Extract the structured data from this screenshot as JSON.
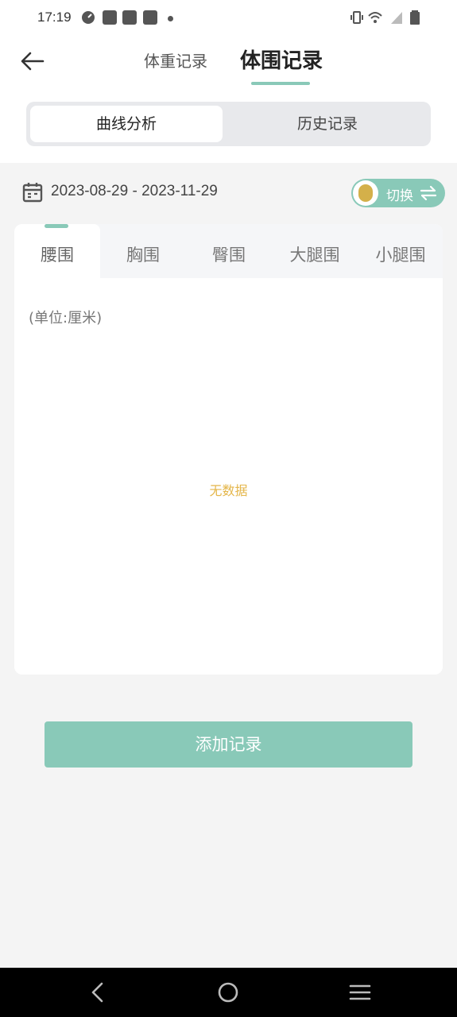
{
  "status_bar": {
    "time": "17:19"
  },
  "header": {
    "tabs": [
      {
        "label": "体重记录",
        "active": false
      },
      {
        "label": "体围记录",
        "active": true
      }
    ]
  },
  "segment": {
    "items": [
      {
        "label": "曲线分析",
        "active": true
      },
      {
        "label": "历史记录",
        "active": false
      }
    ]
  },
  "date_range": "2023-08-29 - 2023-11-29",
  "switch_label": "切换",
  "body_tabs": [
    {
      "label": "腰围",
      "active": true
    },
    {
      "label": "胸围",
      "active": false
    },
    {
      "label": "臀围",
      "active": false
    },
    {
      "label": "大腿围",
      "active": false
    },
    {
      "label": "小腿围",
      "active": false
    }
  ],
  "chart": {
    "unit_label": "(单位:厘米)",
    "empty_text": "无数据"
  },
  "add_button_label": "添加记录",
  "colors": {
    "accent": "#89c9b8",
    "empty_text": "#e4b64a",
    "background": "#f4f4f4"
  }
}
